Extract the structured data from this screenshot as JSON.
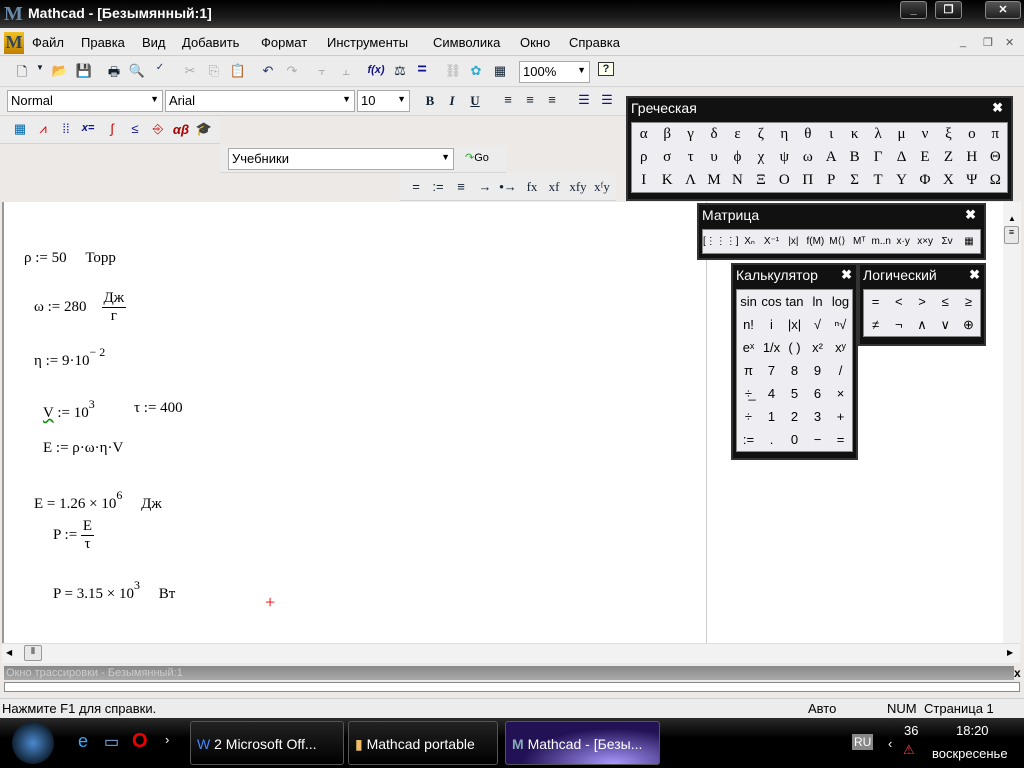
{
  "window": {
    "title": "Mathcad - [Безымянный:1]",
    "logo": "M",
    "min": "_",
    "max": "❐",
    "close": "✕"
  },
  "menu": [
    "Файл",
    "Правка",
    "Вид",
    "Добавить",
    "Формат",
    "Инструменты",
    "Символика",
    "Окно",
    "Справка"
  ],
  "toolbar": {
    "zoom": "100%",
    "help": "?",
    "fx": "f(x)",
    "equals": "="
  },
  "format": {
    "style": "Normal",
    "font": "Arial",
    "size": "10",
    "bold": "B",
    "italic": "I",
    "underline": "U"
  },
  "math_toolbar": {
    "greek_btn": "αβ",
    "eval_btn": "x="
  },
  "resources": {
    "value": "Учебники",
    "go": "Go"
  },
  "evaluation": [
    "=",
    ":=",
    "≡",
    "→",
    "•→",
    "fx",
    "xf",
    "xfy",
    "xᶠy"
  ],
  "worksheet": {
    "rho": "ρ := 50",
    "rho_unit": "Торр",
    "omega": "ω := 280",
    "omega_unit_num": "Дж",
    "omega_unit_den": "г",
    "eta": "η := 9·10",
    "eta_exp": "− 2",
    "v": "V",
    "v_rest": " := 10",
    "v_exp": "3",
    "tau": "τ := 400",
    "e_def": "E := ρ·ω·η·V",
    "e_res": "E = 1.26 × 10",
    "e_exp": "6",
    "e_unit": "Дж",
    "p_def": "P := ",
    "p_num": "E",
    "p_den": "τ",
    "p_res": "P = 3.15 × 10",
    "p_exp": "3",
    "p_unit": "Вт",
    "cursor": "+"
  },
  "palettes": {
    "greek": {
      "title": "Греческая",
      "close": "✖",
      "items": [
        "α",
        "β",
        "γ",
        "δ",
        "ε",
        "ζ",
        "η",
        "θ",
        "ι",
        "κ",
        "λ",
        "μ",
        "ν",
        "ξ",
        "ο",
        "π",
        "ρ",
        "σ",
        "τ",
        "υ",
        "ϕ",
        "χ",
        "ψ",
        "ω",
        "Α",
        "Β",
        "Γ",
        "Δ",
        "Ε",
        "Ζ",
        "Η",
        "Θ",
        "Ι",
        "Κ",
        "Λ",
        "Μ",
        "Ν",
        "Ξ",
        "Ο",
        "Π",
        "Ρ",
        "Σ",
        "Τ",
        "Υ",
        "Φ",
        "Χ",
        "Ψ",
        "Ω"
      ]
    },
    "matrix": {
      "title": "Матрица",
      "close": "✖",
      "items": [
        "[⋮⋮⋮]",
        "Xₙ",
        "X⁻¹",
        "|x|",
        "f(M)",
        "M⟨⟩",
        "Mᵀ",
        "m..n",
        "x·y",
        "x×y",
        "Σv",
        "▦"
      ]
    },
    "calculator": {
      "title": "Калькулятор",
      "close": "✖",
      "items": [
        "sin",
        "cos",
        "tan",
        "ln",
        "log",
        "n!",
        "i",
        "|x|",
        "√",
        "ⁿ√",
        "eˣ",
        "1/x",
        "( )",
        "x²",
        "xʸ",
        "π",
        "7",
        "8",
        "9",
        "/",
        "÷̲",
        "4",
        "5",
        "6",
        "×",
        "÷",
        "1",
        "2",
        "3",
        "+",
        ":=",
        ".",
        "0",
        "−",
        "="
      ]
    },
    "logic": {
      "title": "Логический",
      "close": "✖",
      "items": [
        "=",
        "<",
        ">",
        "≤",
        "≥",
        "≠",
        "¬",
        "∧",
        "∨",
        "⊕"
      ]
    }
  },
  "trace": {
    "title": "Окно трассировки - Безымянный:1",
    "close": "x"
  },
  "status": {
    "help": "Нажмите F1 для справки.",
    "mode": "Авто",
    "num": "NUM",
    "page": "Страница 1"
  },
  "taskbar": {
    "tasks": [
      "2 Microsoft Off...",
      "Mathcad portable",
      "Mathcad - [Безы..."
    ],
    "lang": "RU",
    "temp": "36",
    "time": "18:20",
    "day": "воскресенье"
  }
}
